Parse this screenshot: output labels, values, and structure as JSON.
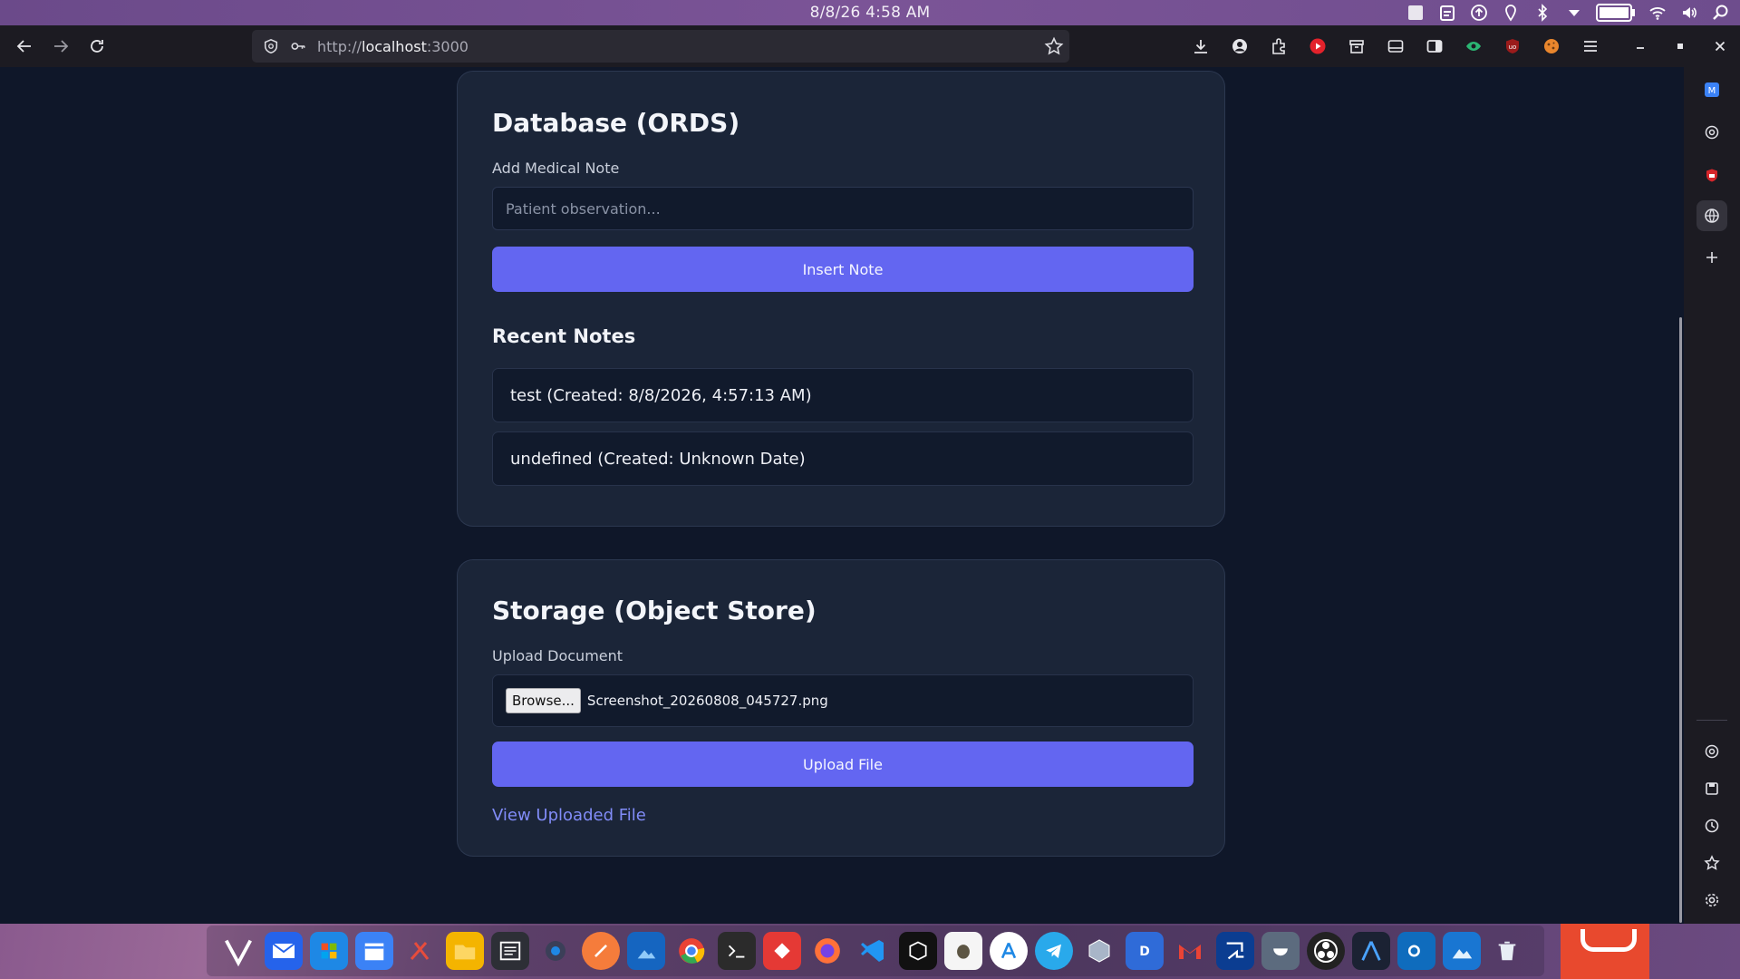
{
  "os": {
    "clock": "8/8/26   4:58 AM",
    "tray_icons": [
      "window-icon",
      "clipboard-icon",
      "upload-icon",
      "location-icon",
      "bluetooth-icon",
      "chevron-down-icon",
      "battery-icon",
      "wifi-icon",
      "volume-icon",
      "search-icon"
    ]
  },
  "browser": {
    "url_prefix": "http://",
    "url_host": "localhost",
    "url_suffix": ":3000",
    "toolbar_icons": [
      "download-icon",
      "account-icon",
      "extensions-icon",
      "youtube-icon",
      "archive-icon",
      "sidebar-icon",
      "reader-icon",
      "eye-icon",
      "ublock-icon",
      "cookie-icon",
      "menu-icon"
    ],
    "window_controls": [
      "minimize-icon",
      "maximize-icon",
      "close-icon"
    ]
  },
  "database_card": {
    "title": "Database (ORDS)",
    "field_label": "Add Medical Note",
    "input_placeholder": "Patient observation...",
    "input_value": "",
    "button_label": "Insert Note",
    "recent_title": "Recent Notes",
    "notes": [
      {
        "text": "test (Created: 8/8/2026, 4:57:13 AM)"
      },
      {
        "text": "undefined (Created: Unknown Date)"
      }
    ]
  },
  "storage_card": {
    "title": "Storage (Object Store)",
    "field_label": "Upload Document",
    "browse_label": "Browse...",
    "file_name": "Screenshot_20260808_045727.png",
    "button_label": "Upload File",
    "link_label": "View Uploaded File"
  },
  "sidebar": {
    "icons": [
      "mail-icon",
      "chatgpt-icon",
      "ublock-icon",
      "globe-icon",
      "plus-icon",
      "chatgpt-icon",
      "save-icon",
      "history-icon",
      "star-icon",
      "settings-icon"
    ]
  },
  "taskbar": {
    "apps": [
      "vivaldi",
      "mail",
      "store",
      "calendar",
      "tools",
      "files",
      "notes",
      "search",
      "brush",
      "photos",
      "chrome",
      "terminal",
      "git",
      "firefox",
      "vscode",
      "box",
      "gimp",
      "appstore",
      "telegram",
      "virtualbox",
      "docs",
      "gmail",
      "remote",
      "monitor",
      "obs",
      "arch",
      "outlook",
      "images",
      "trash"
    ]
  }
}
